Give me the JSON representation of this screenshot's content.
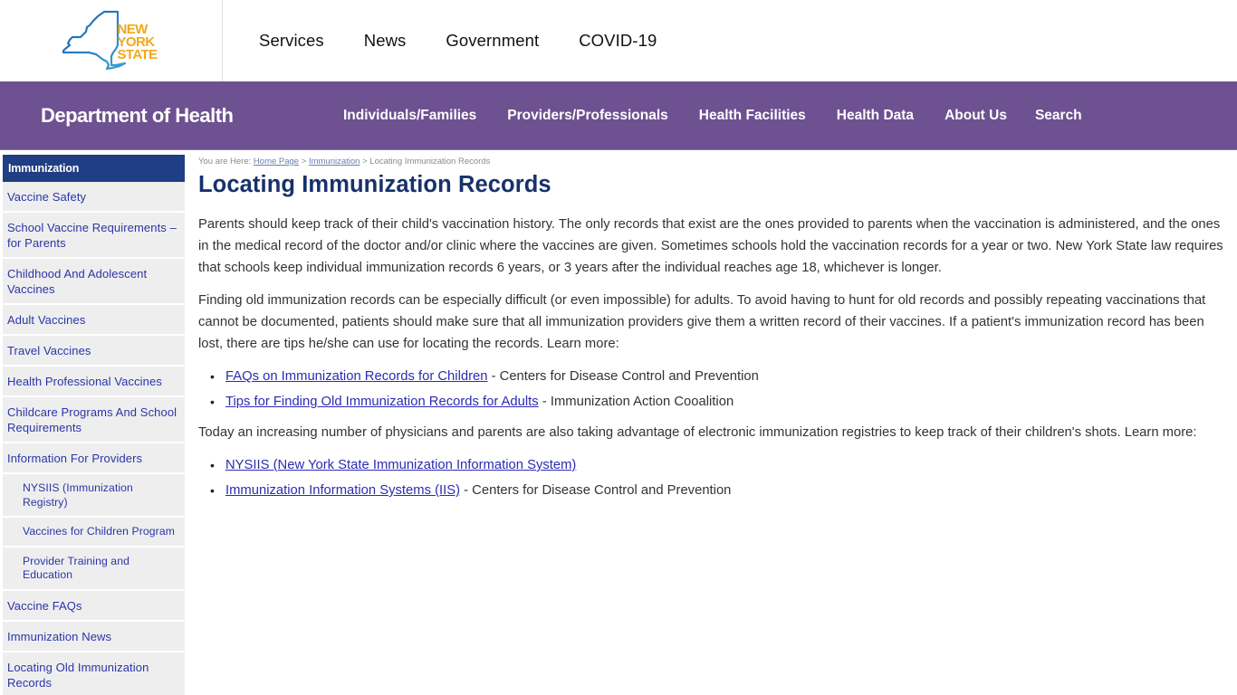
{
  "header": {
    "logo": {
      "line1": "NEW",
      "line2": "YORK",
      "line3": "STATE",
      "alt": "New York State"
    },
    "global_nav": [
      "Services",
      "News",
      "Government",
      "COVID-19"
    ]
  },
  "agency": {
    "title": "Department of Health",
    "nav": [
      "Individuals/Families",
      "Providers/Professionals",
      "Health Facilities",
      "Health Data",
      "About Us",
      "Search"
    ]
  },
  "sidebar": {
    "heading": "Immunization",
    "items": [
      {
        "label": "Vaccine Safety",
        "sub": false
      },
      {
        "label": "School Vaccine Requirements – for Parents",
        "sub": false
      },
      {
        "label": "Childhood And Adolescent Vaccines",
        "sub": false
      },
      {
        "label": "Adult Vaccines",
        "sub": false
      },
      {
        "label": "Travel Vaccines",
        "sub": false
      },
      {
        "label": "Health Professional Vaccines",
        "sub": false
      },
      {
        "label": "Childcare Programs And School Requirements",
        "sub": false
      },
      {
        "label": "Information For Providers",
        "sub": false
      },
      {
        "label": "NYSIIS (Immunization Registry)",
        "sub": true
      },
      {
        "label": "Vaccines for Children Program",
        "sub": true
      },
      {
        "label": "Provider Training and Education",
        "sub": true
      },
      {
        "label": "Vaccine FAQs",
        "sub": false
      },
      {
        "label": "Immunization News",
        "sub": false
      },
      {
        "label": "Locating Old Immunization Records",
        "sub": false
      }
    ]
  },
  "breadcrumb": {
    "prefix": "You are Here:",
    "items": [
      "Home Page",
      "Immunization"
    ],
    "separator": ">",
    "current": "Locating Immunization Records"
  },
  "main": {
    "title": "Locating Immunization Records",
    "paragraphs": [
      "Parents should keep track of their child's vaccination history. The only records that exist are the ones provided to parents when the vaccination is administered, and the ones in the medical record of the doctor and/or clinic where the vaccines are given. Sometimes schools hold the vaccination records for a year or two. New York State law requires that schools keep individual immunization records 6 years, or 3 years after the individual reaches age 18, whichever is longer.",
      "Finding old immunization records can be especially difficult (or even impossible) for adults. To avoid having to hunt for old records and possibly repeating vaccinations that cannot be documented, patients should make sure that all immunization providers give them a written record of their vaccines. If a patient's immunization record has been lost, there are tips he/she can use for locating the records. Learn more:",
      "Today an increasing number of physicians and parents are also taking advantage of electronic immunization registries to keep track of their children's shots. Learn more:"
    ],
    "list1": [
      {
        "link": "FAQs on Immunization Records for Children",
        "suffix": " - Centers for Disease Control and Prevention"
      },
      {
        "link": "Tips for Finding Old Immunization Records for Adults",
        "suffix": " - Immunization Action Cooalition"
      }
    ],
    "list2": [
      {
        "link": "NYSIIS (New York State Immunization Information System)",
        "suffix": ""
      },
      {
        "link": "Immunization Information Systems (IIS)",
        "suffix": " - Centers for Disease Control and Prevention"
      }
    ]
  },
  "colors": {
    "agency_bar": "#6e5190",
    "sidebar_heading": "#1f3e83",
    "sidebar_link": "#2a36a8",
    "title": "#17316b",
    "logo_text": "#f1a81c",
    "logo_outline": "#2a6ab8"
  }
}
